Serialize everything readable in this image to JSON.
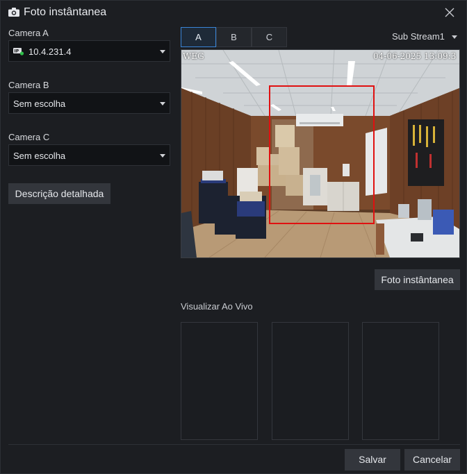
{
  "dialog": {
    "title": "Foto instântanea",
    "title_icon": "camera-icon",
    "close_icon": "close-icon"
  },
  "camera_a": {
    "label": "Camera A",
    "value": "10.4.231.4",
    "icon": "ip-camera-icon"
  },
  "camera_b": {
    "label": "Camera B",
    "value": "Sem escolha"
  },
  "camera_c": {
    "label": "Camera C",
    "value": "Sem escolha"
  },
  "details_button": "Descrição detalhada",
  "tabs": [
    {
      "label": "A",
      "active": true
    },
    {
      "label": "B",
      "active": false
    },
    {
      "label": "C",
      "active": false
    }
  ],
  "stream": {
    "value": "Sub Stream1"
  },
  "video": {
    "osd_left": "WEG",
    "osd_right": "04-06-2025 13:09:3"
  },
  "snapshot_button": "Foto instântanea",
  "live_preview": {
    "label": "Visualizar Ao Vivo"
  },
  "footer": {
    "save": "Salvar",
    "cancel": "Cancelar"
  },
  "colors": {
    "accent": "#3a86d8",
    "roi": "#e01010",
    "background": "#1c1e22"
  }
}
